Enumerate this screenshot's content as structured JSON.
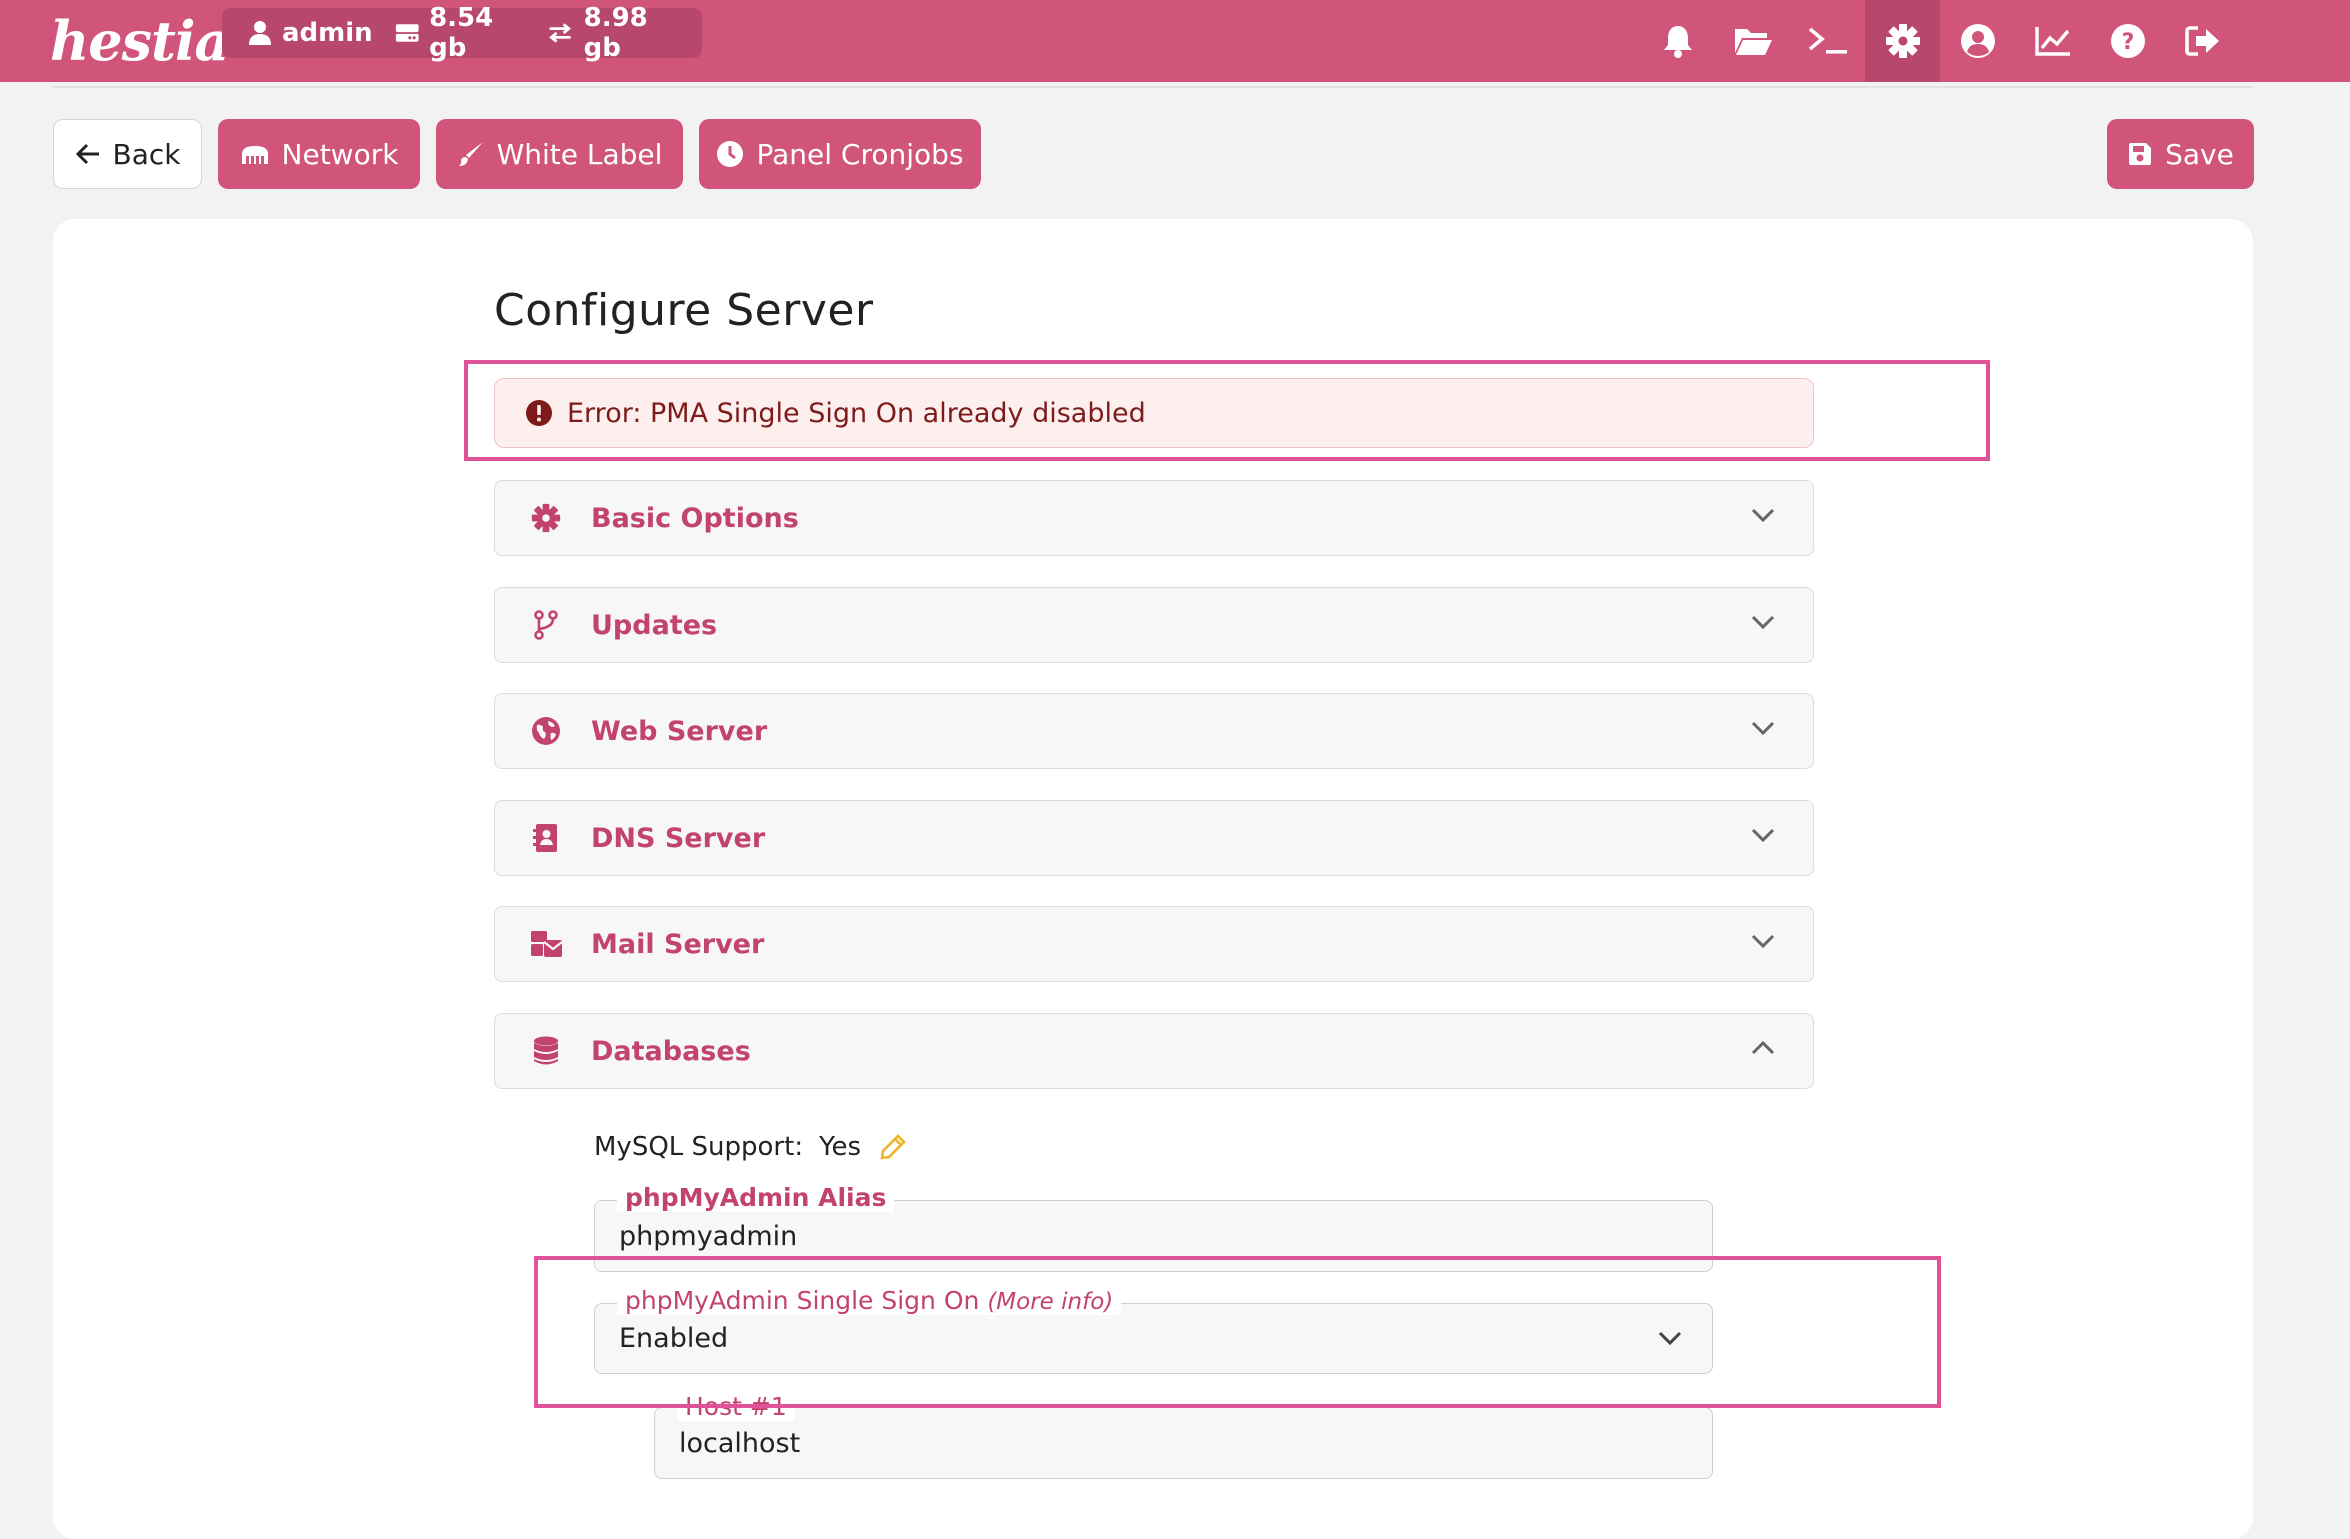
{
  "topbar": {
    "logo": "hestia",
    "user": "admin",
    "disk": "8.54 gb",
    "bandwidth": "8.98 gb",
    "icons": [
      "bell-icon",
      "folder-icon",
      "terminal-icon",
      "gear-icon",
      "user-circle-icon",
      "chart-icon",
      "help-icon",
      "logout-icon"
    ],
    "active_icon": "gear-icon"
  },
  "toolbar": {
    "back": "Back",
    "network": "Network",
    "white_label": "White Label",
    "panel_cronjobs": "Panel Cronjobs",
    "save": "Save"
  },
  "page": {
    "title": "Configure Server",
    "error": "Error: PMA Single Sign On already disabled"
  },
  "sections": [
    {
      "label": "Basic Options",
      "icon": "gear-icon",
      "expanded": false
    },
    {
      "label": "Updates",
      "icon": "branch-icon",
      "expanded": false
    },
    {
      "label": "Web Server",
      "icon": "globe-icon",
      "expanded": false
    },
    {
      "label": "DNS Server",
      "icon": "address-book-icon",
      "expanded": false
    },
    {
      "label": "Mail Server",
      "icon": "mail-bulk-icon",
      "expanded": false
    },
    {
      "label": "Databases",
      "icon": "database-icon",
      "expanded": true
    }
  ],
  "databases": {
    "mysql_label": "MySQL Support:",
    "mysql_value": "Yes",
    "pma_alias_label": "phpMyAdmin Alias",
    "pma_alias_value": "phpmyadmin",
    "pma_sso_label": "phpMyAdmin Single Sign On",
    "pma_sso_more": "(More info)",
    "pma_sso_value": "Enabled",
    "host_label": "Host #1",
    "host_value": "localhost"
  },
  "colors": {
    "brand": "#d1557a",
    "brand_dark": "#b8486b",
    "section_text": "#c2436b",
    "error_text": "#7d1b1b",
    "error_bg": "#fcefee",
    "highlight": "#e0539a",
    "edit_icon": "#f0b429"
  }
}
